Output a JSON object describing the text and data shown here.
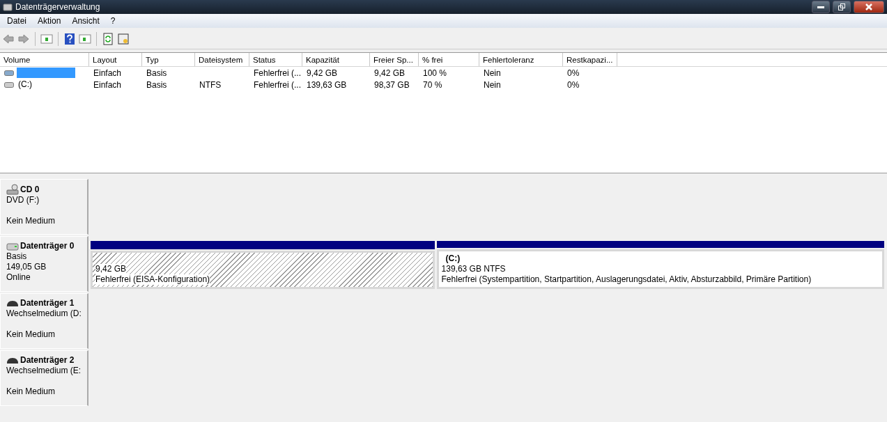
{
  "window": {
    "title": "Datenträgerverwaltung"
  },
  "menu": [
    "Datei",
    "Aktion",
    "Ansicht",
    "?"
  ],
  "volumes": {
    "columns": [
      "Volume",
      "Layout",
      "Typ",
      "Dateisystem",
      "Status",
      "Kapazität",
      "Freier Sp...",
      "% frei",
      "Fehlertoleranz",
      "Restkapazi..."
    ],
    "rows": [
      {
        "selected": true,
        "cells": [
          "",
          "Einfach",
          "Basis",
          "",
          "Fehlerfrei (...",
          "9,42 GB",
          "9,42 GB",
          "100 %",
          "Nein",
          "0%"
        ]
      },
      {
        "selected": false,
        "cells": [
          "(C:)",
          "Einfach",
          "Basis",
          "NTFS",
          "Fehlerfrei (...",
          "139,63 GB",
          "98,37 GB",
          "70 %",
          "Nein",
          "0%"
        ]
      }
    ]
  },
  "disks": [
    {
      "kind": "cd",
      "name": "CD 0",
      "lines": [
        "DVD (F:)"
      ],
      "media": "Kein Medium"
    },
    {
      "kind": "hdd",
      "name": "Datenträger 0",
      "lines": [
        "Basis",
        "149,05 GB",
        "Online"
      ],
      "partitions": [
        {
          "hatched": true,
          "lines": [
            "9,42 GB",
            "Fehlerfrei (EISA-Konfiguration)"
          ]
        },
        {
          "hatched": false,
          "label": "(C:)",
          "lines": [
            "139,63 GB NTFS",
            "Fehlerfrei (Systempartition, Startpartition, Auslagerungsdatei, Aktiv, Absturzabbild, Primäre Partition)"
          ]
        }
      ]
    },
    {
      "kind": "removable",
      "name": "Datenträger 1",
      "lines": [
        "Wechselmedium (D:"
      ],
      "media": "Kein Medium"
    },
    {
      "kind": "removable",
      "name": "Datenträger 2",
      "lines": [
        "Wechselmedium (E:"
      ],
      "media": "Kein Medium"
    }
  ]
}
